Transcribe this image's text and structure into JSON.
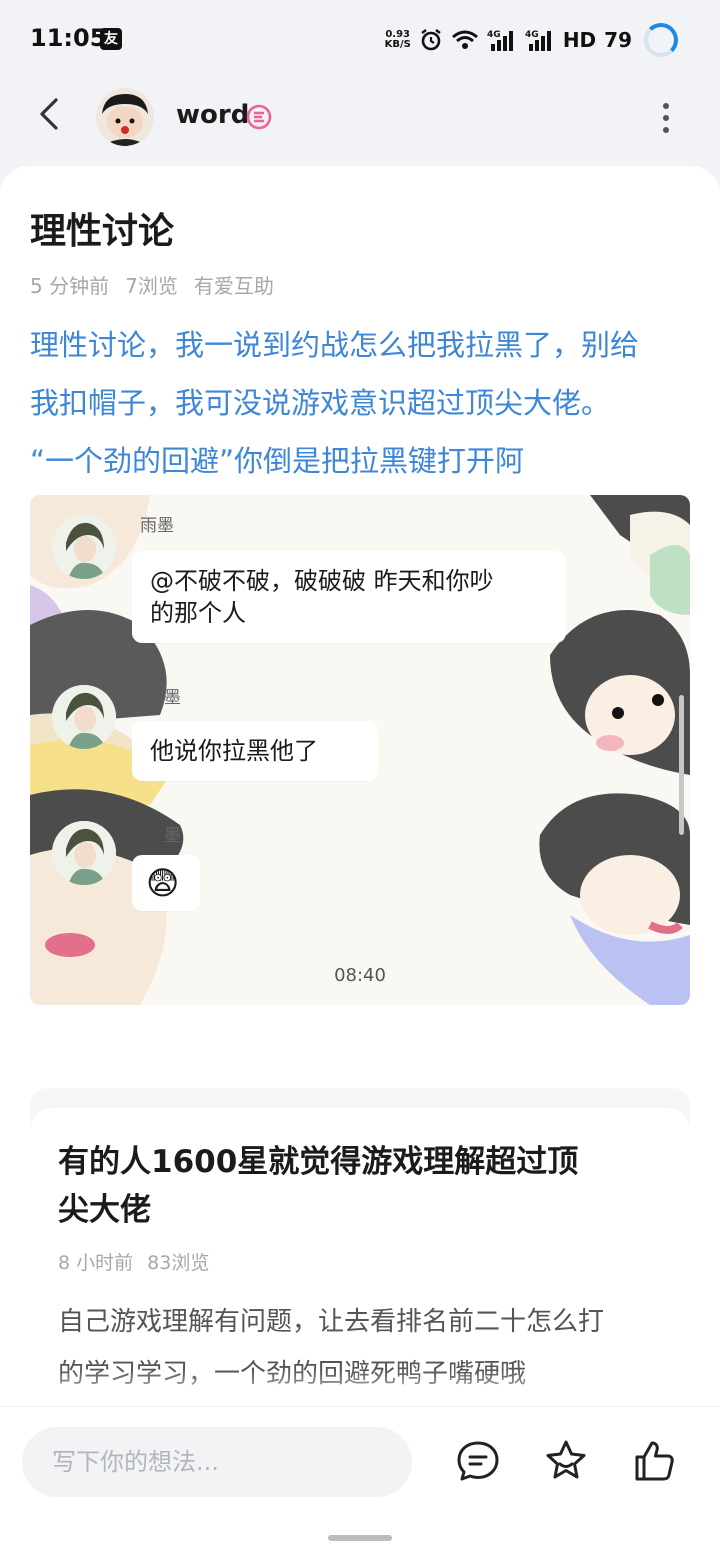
{
  "status_bar": {
    "time": "11:05",
    "app_icon": "友",
    "net_speed_value": "0.93",
    "net_speed_unit": "KB/S",
    "network_label": "HD",
    "battery": "79"
  },
  "header": {
    "username": "word"
  },
  "post": {
    "title": "理性讨论",
    "meta": {
      "time": "5 分钟前",
      "views": "7浏览",
      "category": "有爱互助"
    },
    "body_lines": [
      "理性讨论，我一说到约战怎么把我拉黑了，别给",
      "我扣帽子，我可没说游戏意识超过顶尖大佬。",
      "“一个劲的回避”你倒是把拉黑键打开阿"
    ]
  },
  "chat_image": {
    "sender_name": "雨墨",
    "sender_name_partial_2": "墨",
    "sender_name_partial_3": "墨",
    "messages": [
      {
        "line1": "@不破不破，破破破 昨天和你吵",
        "line2": "的那个人"
      },
      {
        "line1": "他说你拉黑他了"
      },
      {
        "line1": "😨"
      }
    ],
    "time": "08:40"
  },
  "related": {
    "title_lines": [
      "有的人1600星就觉得游戏理解超过顶",
      "尖大佬"
    ],
    "meta": {
      "time": "8 小时前",
      "views": "83浏览"
    },
    "body_lines": [
      "自己游戏理解有问题，让去看排名前二十怎么打",
      "的学习学习，一个劲的回避死鸭子嘴硬哦"
    ]
  },
  "bottom_bar": {
    "comment_placeholder": "写下你的想法..."
  },
  "colors": {
    "accent_link": "#3d86d8",
    "page_bg": "#f1f3f6",
    "badge_pink": "#f06292"
  }
}
